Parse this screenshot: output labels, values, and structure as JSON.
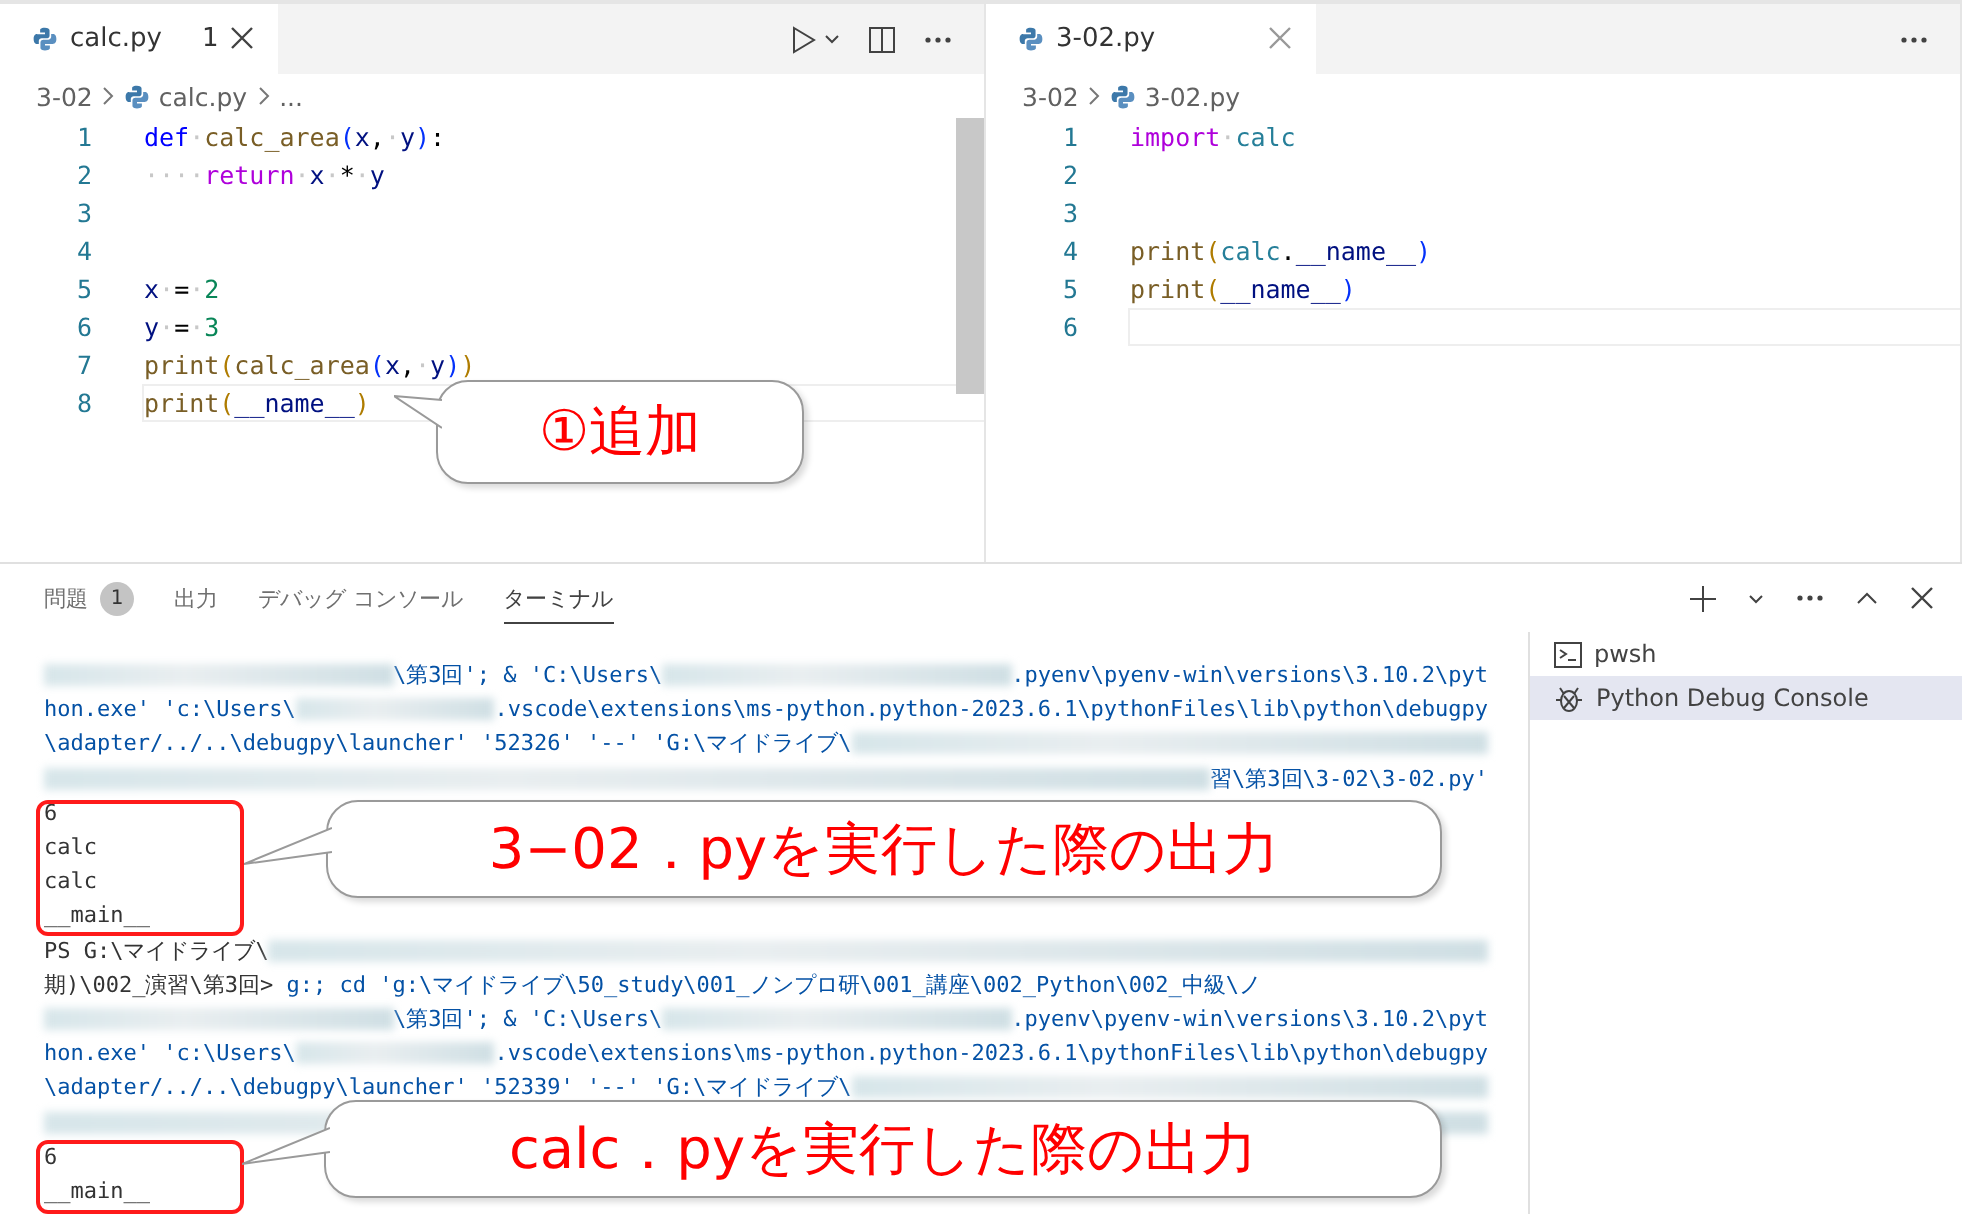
{
  "editors": [
    {
      "tab": {
        "label": "calc.py",
        "badge": "1",
        "selected": true
      },
      "run_controls": true,
      "breadcrumb": [
        {
          "kind": "folder",
          "text": "3-02"
        },
        {
          "kind": "file",
          "text": "calc.py"
        },
        {
          "kind": "ellipsis",
          "text": "..."
        }
      ],
      "lines": [
        {
          "number": "1",
          "current": false,
          "tokens": [
            {
              "kind": "keyword",
              "text": "def"
            },
            {
              "kind": "whitespace",
              "text": "·"
            },
            {
              "kind": "function",
              "text": "calc_area"
            },
            {
              "kind": "bracket_inner",
              "text": "("
            },
            {
              "kind": "param",
              "text": "x"
            },
            {
              "kind": "plain",
              "text": ","
            },
            {
              "kind": "whitespace",
              "text": "·"
            },
            {
              "kind": "param",
              "text": "y"
            },
            {
              "kind": "bracket_inner",
              "text": ")"
            },
            {
              "kind": "plain",
              "text": ":"
            }
          ]
        },
        {
          "number": "2",
          "current": false,
          "tokens": [
            {
              "kind": "whitespace",
              "text": "····"
            },
            {
              "kind": "control",
              "text": "return"
            },
            {
              "kind": "whitespace",
              "text": "·"
            },
            {
              "kind": "param",
              "text": "x"
            },
            {
              "kind": "whitespace",
              "text": "·"
            },
            {
              "kind": "plain",
              "text": "*"
            },
            {
              "kind": "whitespace",
              "text": "·"
            },
            {
              "kind": "param",
              "text": "y"
            }
          ]
        },
        {
          "number": "3",
          "current": false
        },
        {
          "number": "4",
          "current": false
        },
        {
          "number": "5",
          "current": false,
          "tokens": [
            {
              "kind": "param",
              "text": "x"
            },
            {
              "kind": "whitespace",
              "text": "·"
            },
            {
              "kind": "plain",
              "text": "="
            },
            {
              "kind": "whitespace",
              "text": "·"
            },
            {
              "kind": "number",
              "text": "2"
            }
          ]
        },
        {
          "number": "6",
          "current": false,
          "tokens": [
            {
              "kind": "param",
              "text": "y"
            },
            {
              "kind": "whitespace",
              "text": "·"
            },
            {
              "kind": "plain",
              "text": "="
            },
            {
              "kind": "whitespace",
              "text": "·"
            },
            {
              "kind": "number",
              "text": "3"
            }
          ]
        },
        {
          "number": "7",
          "current": false,
          "tokens": [
            {
              "kind": "function",
              "text": "print"
            },
            {
              "kind": "bracket",
              "text": "("
            },
            {
              "kind": "function",
              "text": "calc_area"
            },
            {
              "kind": "bracket_inner",
              "text": "("
            },
            {
              "kind": "param",
              "text": "x"
            },
            {
              "kind": "plain",
              "text": ","
            },
            {
              "kind": "whitespace",
              "text": "·"
            },
            {
              "kind": "param",
              "text": "y"
            },
            {
              "kind": "bracket_inner",
              "text": ")"
            },
            {
              "kind": "bracket",
              "text": ")"
            }
          ]
        },
        {
          "number": "8",
          "current": true,
          "tokens": [
            {
              "kind": "function",
              "text": "print"
            },
            {
              "kind": "bracket",
              "text": "("
            },
            {
              "kind": "param",
              "text": "__name__"
            },
            {
              "kind": "bracket",
              "text": ")"
            }
          ]
        }
      ]
    },
    {
      "tab": {
        "label": "3-02.py",
        "selected": true
      },
      "run_controls": false,
      "breadcrumb": [
        {
          "kind": "folder",
          "text": "3-02"
        },
        {
          "kind": "file",
          "text": "3-02.py"
        }
      ],
      "lines": [
        {
          "number": "1",
          "current": false,
          "tokens": [
            {
              "kind": "control",
              "text": "import"
            },
            {
              "kind": "whitespace",
              "text": "·"
            },
            {
              "kind": "module",
              "text": "calc"
            }
          ]
        },
        {
          "number": "2",
          "current": false
        },
        {
          "number": "3",
          "current": false
        },
        {
          "number": "4",
          "current": false,
          "tokens": [
            {
              "kind": "function",
              "text": "print"
            },
            {
              "kind": "bracket",
              "text": "("
            },
            {
              "kind": "module",
              "text": "calc"
            },
            {
              "kind": "plain",
              "text": "."
            },
            {
              "kind": "param",
              "text": "__name__"
            },
            {
              "kind": "bracket_inner",
              "text": ")"
            }
          ]
        },
        {
          "number": "5",
          "current": false,
          "tokens": [
            {
              "kind": "function",
              "text": "print"
            },
            {
              "kind": "bracket",
              "text": "("
            },
            {
              "kind": "param",
              "text": "__name__"
            },
            {
              "kind": "bracket_inner",
              "text": ")"
            }
          ]
        },
        {
          "number": "6",
          "current": true
        }
      ]
    }
  ],
  "panel": {
    "tabs": [
      {
        "label": "問題",
        "badge": "1",
        "selected": false
      },
      {
        "label": "出力",
        "selected": false
      },
      {
        "label": "デバッグ コンソール",
        "selected": false
      },
      {
        "label": "ターミナル",
        "selected": true
      }
    ],
    "terminal_lines": [
      [
        {
          "kind": "redacted"
        },
        {
          "kind": "text",
          "text": "\\第3回'; & 'C:\\Users\\"
        },
        {
          "kind": "redacted"
        },
        {
          "kind": "text",
          "text": ".pyenv\\pyenv-win\\versions\\3.10.2\\pyt"
        }
      ],
      [
        {
          "kind": "text",
          "text": "hon.exe' 'c:\\Users\\"
        },
        {
          "kind": "redacted"
        },
        {
          "kind": "text",
          "text": ".vscode\\extensions\\ms-python.python-2023.6.1\\pythonFiles\\lib\\python\\debugpy"
        }
      ],
      [
        {
          "kind": "text",
          "text": "\\adapter/../..\\debugpy\\launcher' '52326' '--' 'G:\\マイドライブ\\"
        },
        {
          "kind": "redacted"
        }
      ],
      [
        {
          "kind": "redacted"
        },
        {
          "kind": "text",
          "text": "習\\第3回\\3-02\\3-02.py'"
        }
      ],
      [
        {
          "kind": "output",
          "text": "6"
        }
      ],
      [
        {
          "kind": "output",
          "text": "calc"
        }
      ],
      [
        {
          "kind": "output",
          "text": "calc"
        }
      ],
      [
        {
          "kind": "output",
          "text": "__main__"
        }
      ],
      [
        {
          "kind": "output",
          "text": "PS G:\\マイドライブ\\"
        },
        {
          "kind": "redacted"
        }
      ],
      [
        {
          "kind": "output",
          "text": "期)\\002_演習\\第3回> "
        },
        {
          "kind": "text",
          "text": "g:; cd 'g:\\マイドライブ\\50_study\\001_ノンプロ研\\001_講座\\002_Python\\002_中級\\ノ"
        }
      ],
      [
        {
          "kind": "redacted"
        },
        {
          "kind": "text",
          "text": "\\第3回'; & 'C:\\Users\\"
        },
        {
          "kind": "redacted"
        },
        {
          "kind": "text",
          "text": ".pyenv\\pyenv-win\\versions\\3.10.2\\pyt"
        }
      ],
      [
        {
          "kind": "text",
          "text": "hon.exe' 'c:\\Users\\"
        },
        {
          "kind": "redacted"
        },
        {
          "kind": "text",
          "text": ".vscode\\extensions\\ms-python.python-2023.6.1\\pythonFiles\\lib\\python\\debugpy"
        }
      ],
      [
        {
          "kind": "text",
          "text": "\\adapter/../..\\debugpy\\launcher' '52339' '--' 'G:\\マイドライブ\\"
        },
        {
          "kind": "redacted"
        }
      ],
      [
        {
          "kind": "redacted"
        }
      ],
      [
        {
          "kind": "output",
          "text": "6"
        }
      ],
      [
        {
          "kind": "output",
          "text": "__main__"
        }
      ]
    ],
    "terminals": [
      {
        "kind": "shell",
        "label": "pwsh",
        "selected": false
      },
      {
        "kind": "debug",
        "label": "Python Debug Console",
        "selected": true
      }
    ]
  },
  "callouts": [
    {
      "text": "①追加",
      "frame": false
    },
    {
      "text": "3−02．pyを実行した際の出力",
      "frame": true
    },
    {
      "text": "calc．pyを実行した際の出力",
      "frame": true
    }
  ]
}
